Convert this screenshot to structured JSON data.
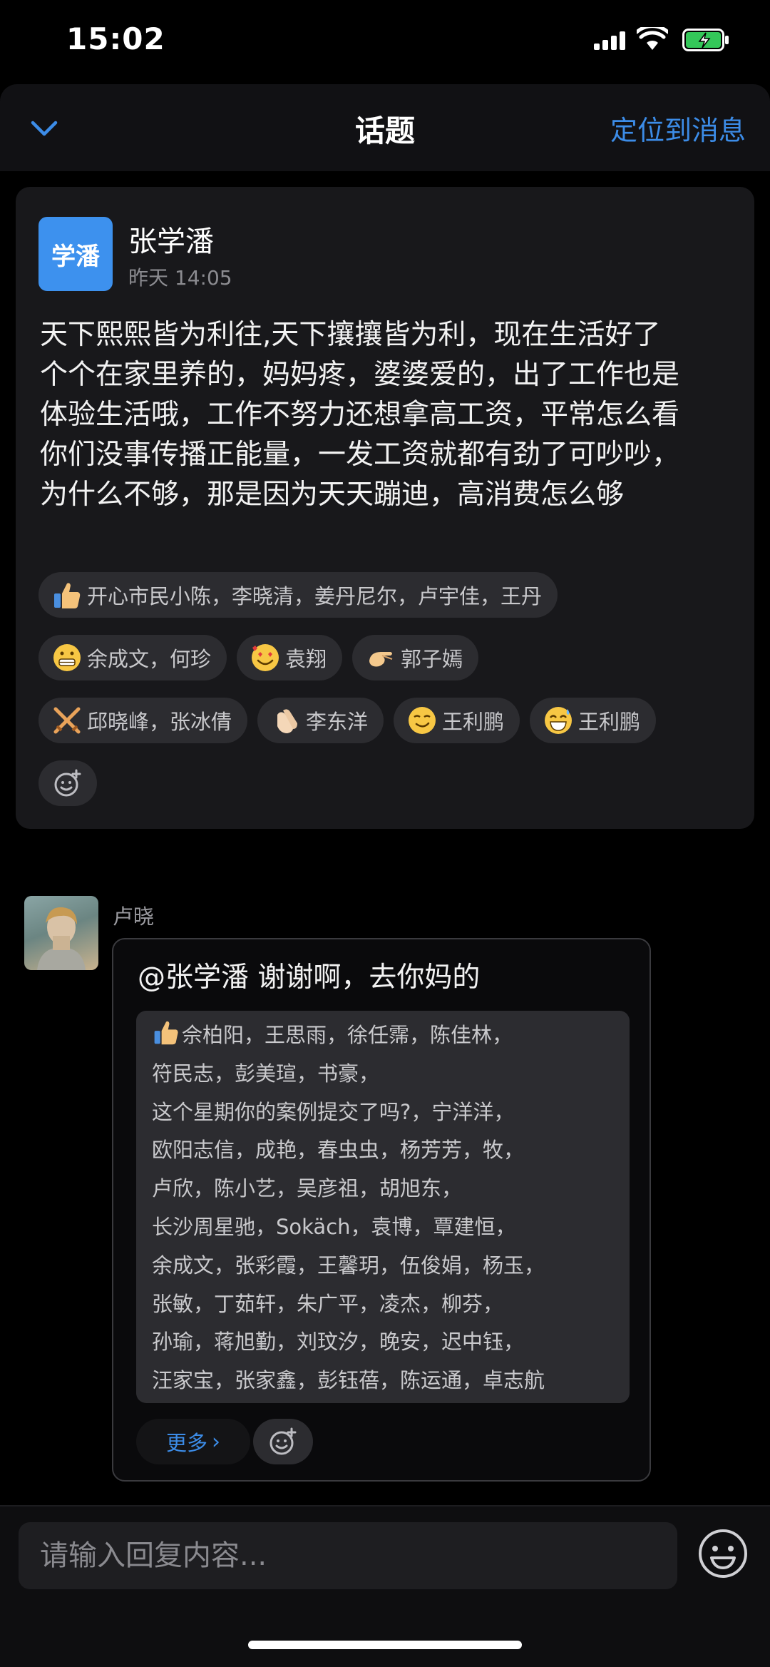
{
  "status_bar": {
    "time": "15:02"
  },
  "nav": {
    "title": "话题",
    "locate_label": "定位到消息"
  },
  "topic": {
    "author_avatar_text": "学潘",
    "author_name": "张学潘",
    "timestamp": "昨天 14:05",
    "body": " 天下熙熙皆为利往,天下攘攘皆为利，现在生活好了个个在家里养的，妈妈疼，婆婆爱的，出了工作也是体验生活哦，工作不努力还想拿高工资，平常怎么看你们没事传播正能量，一发工资就都有劲了可吵吵，为什么不够，那是因为天天蹦迪，高消费怎么够",
    "reactions": [
      {
        "icon": "thumbs-up-icon",
        "names": "开心市民小陈，李晓清，姜丹尼尔，卢宇佳，王丹"
      },
      {
        "icon": "grimace-emoji-icon",
        "names": "余成文，何珍"
      },
      {
        "icon": "smiling-hearts-emoji-icon",
        "names": "袁翔"
      },
      {
        "icon": "pinching-hand-icon",
        "names": "郭子嫣"
      },
      {
        "icon": "crossed-swords-icon",
        "names": "邱晓峰，张冰倩"
      },
      {
        "icon": "clapping-hands-icon",
        "names": "李东洋"
      },
      {
        "icon": "smirk-emoji-icon",
        "names": "王利鹏"
      },
      {
        "icon": "grin-sweat-emoji-icon",
        "names": "王利鹏"
      }
    ]
  },
  "reply": {
    "author_name": "卢晓",
    "text": "@张学潘 谢谢啊，去你妈的",
    "likers_lines": [
      "佘柏阳，王思雨，徐任霈，陈佳林，",
      "符民志，彭美瑄，书豪，",
      "这个星期你的案例提交了吗?，宁洋洋，",
      "欧阳志信，成艳，春虫虫，杨芳芳，牧，",
      "卢欣，陈小艺，吴彦祖，胡旭东，",
      "长沙周星驰，Sokäch，袁博，覃建恒，",
      "余成文，张彩霞，王馨玥，伍俊娟，杨玉，",
      "张敏，丁茹轩，朱广平，凌杰，柳芬，",
      "孙瑜，蒋旭勤，刘玟汐，晚安，迟中钰，",
      "汪家宝，张家鑫，彭钰蓓，陈运通，卓志航"
    ],
    "more_label": "更多",
    "more_chevron": "›"
  },
  "input": {
    "placeholder": "请输入回复内容..."
  },
  "colors": {
    "accent": "#3c8ce7",
    "avatar_blue": "#3d91ee",
    "card_bg": "#18181b",
    "chip_bg": "#2c2c30"
  }
}
